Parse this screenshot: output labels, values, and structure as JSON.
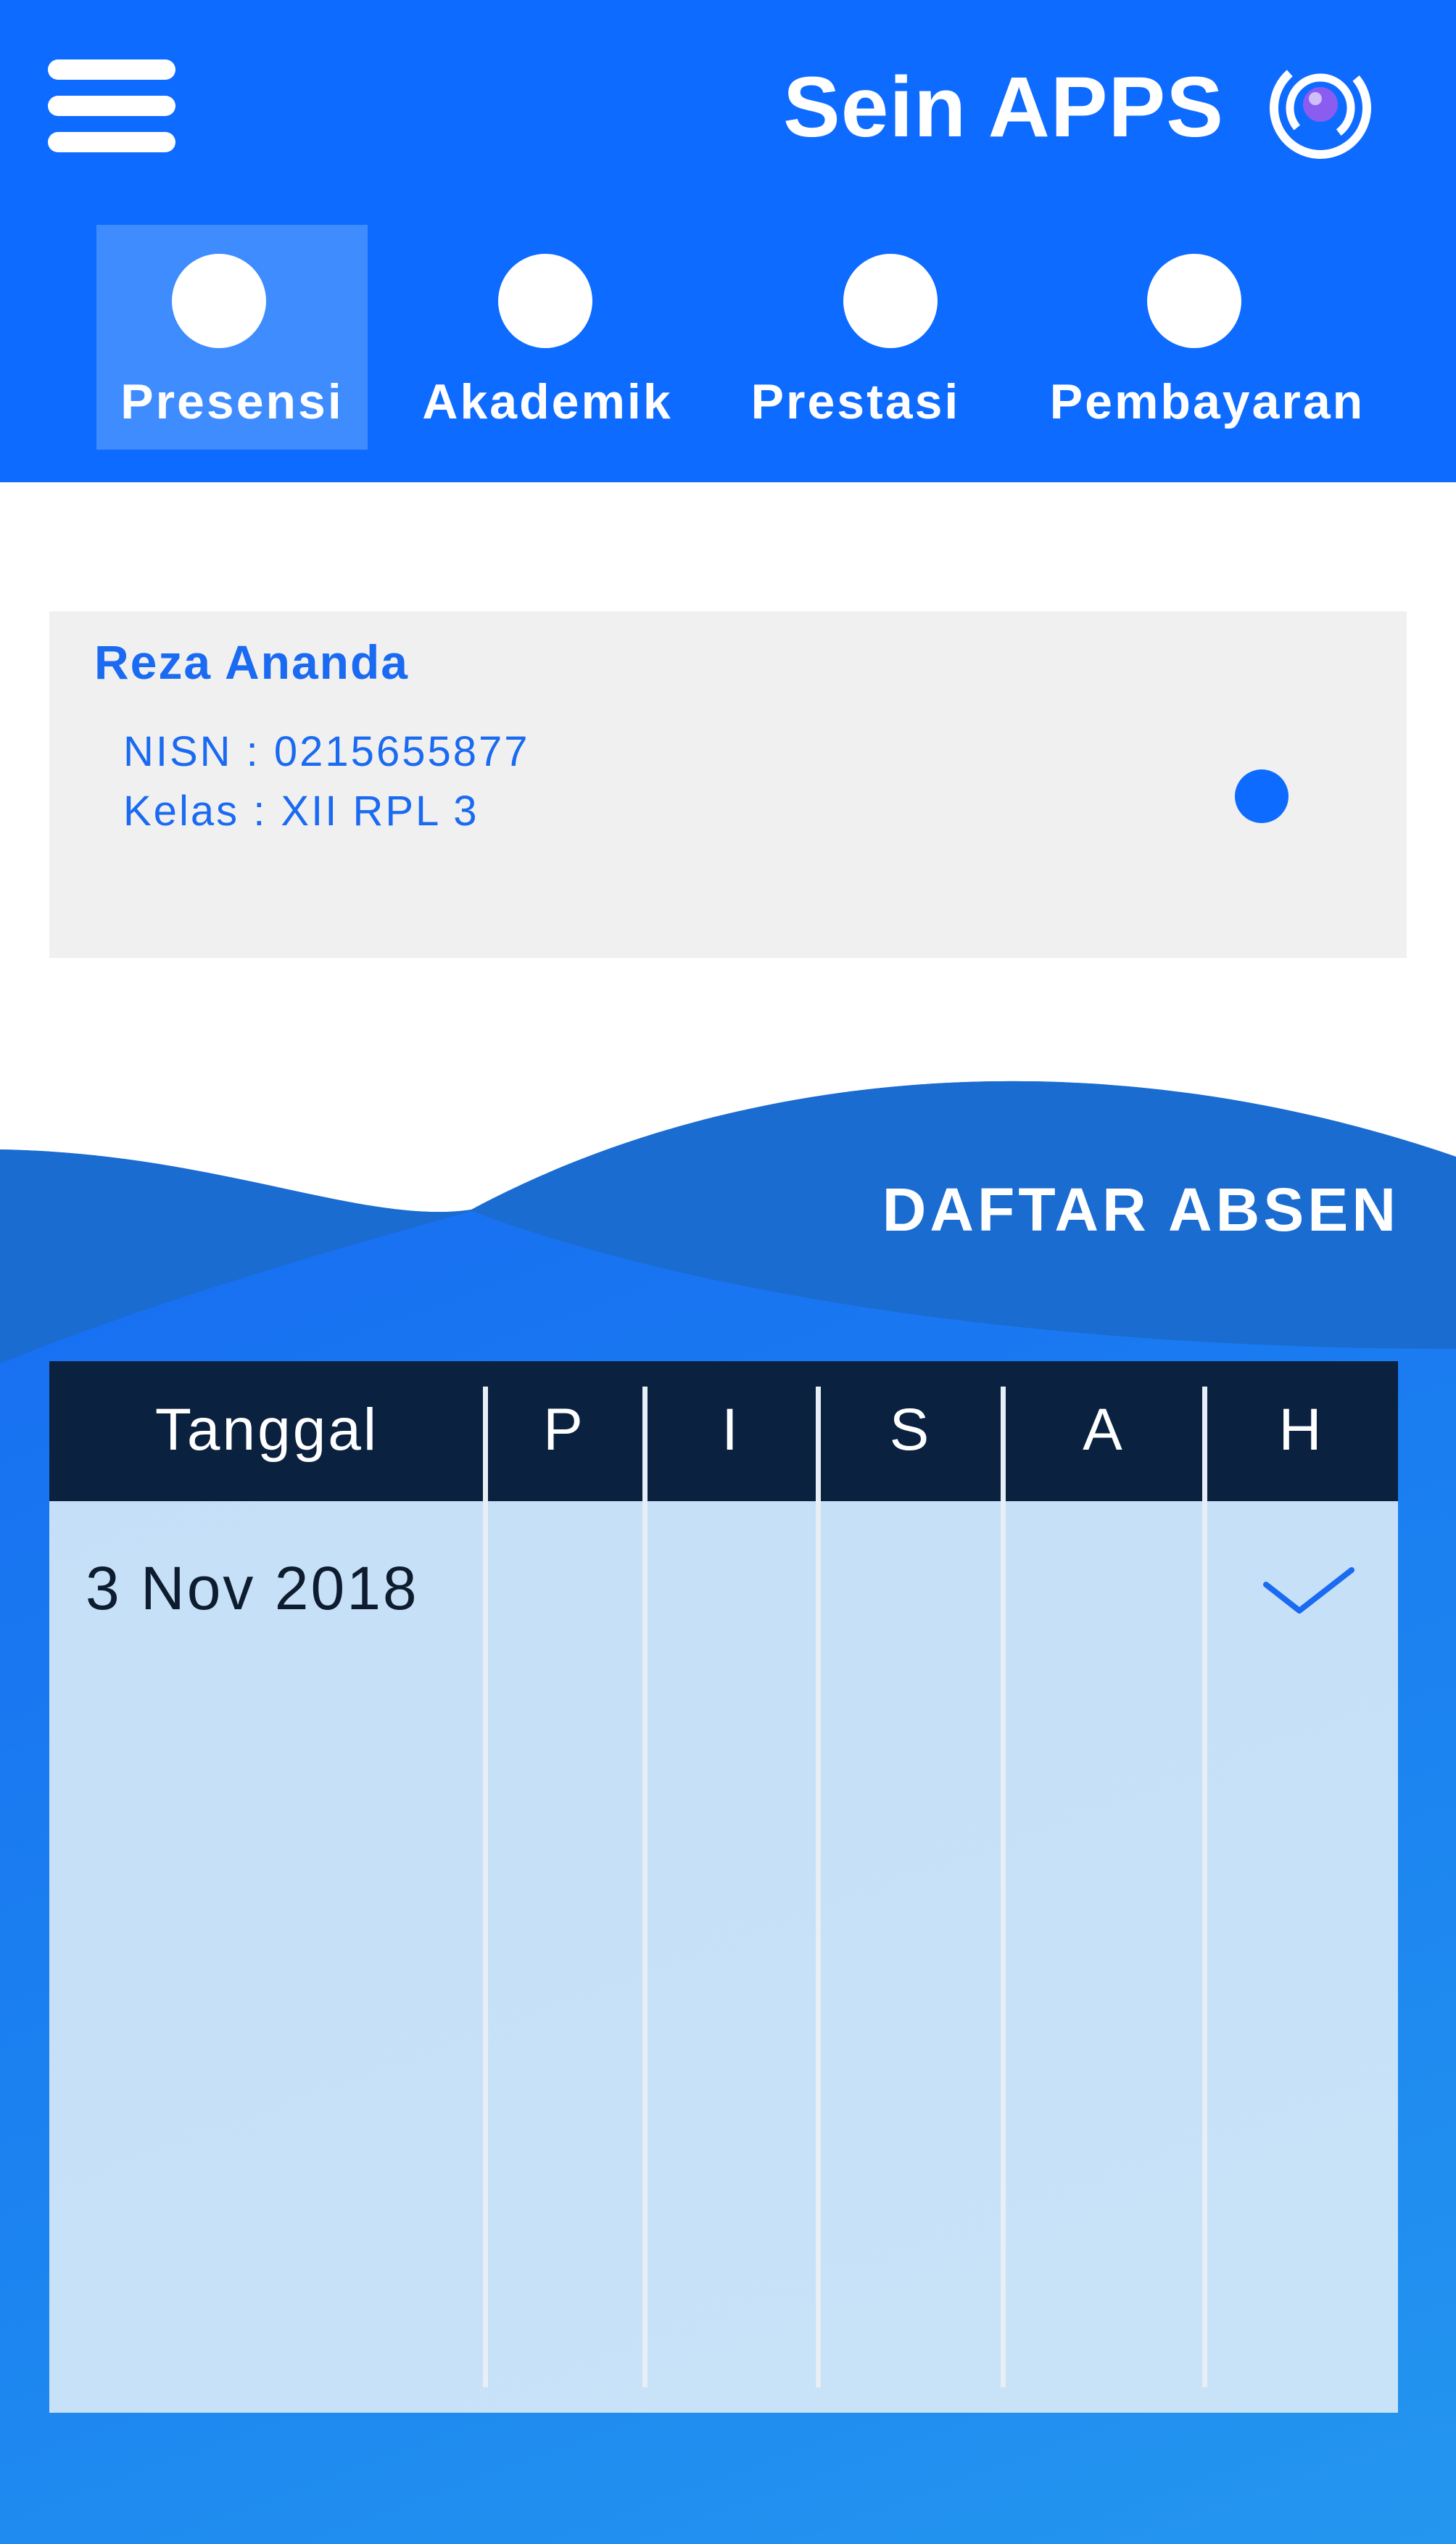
{
  "header": {
    "title": "Sein APPS",
    "menu_icon": "hamburger-menu-icon",
    "logo_icon": "swirl-logo-icon",
    "background": "#0e6bff"
  },
  "tabs": [
    {
      "label": "Presensi",
      "active": true,
      "icon": "circle-icon"
    },
    {
      "label": "Akademik",
      "active": false,
      "icon": "circle-icon"
    },
    {
      "label": "Prestasi",
      "active": false,
      "icon": "circle-icon"
    },
    {
      "label": "Pembayaran",
      "active": false,
      "icon": "circle-icon"
    }
  ],
  "profile": {
    "name": "Reza Ananda",
    "nisn": "NISN : 0215655877",
    "kelas": "Kelas : XII RPL 3",
    "status_color": "#0e6bff"
  },
  "attendance": {
    "title": "DAFTAR ABSEN",
    "columns": [
      "Tanggal",
      "P",
      "I",
      "S",
      "A",
      "H"
    ],
    "rows": [
      {
        "date": "3 Nov 2018",
        "P": false,
        "I": false,
        "S": false,
        "A": false,
        "H": true
      }
    ],
    "header_color": "#0a213f",
    "check_color": "#1a6af2"
  }
}
